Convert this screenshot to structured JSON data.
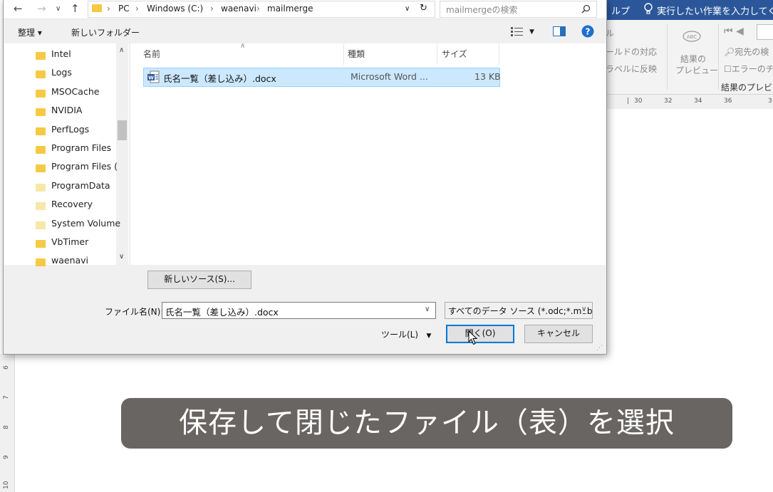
{
  "word": {
    "ribbon_tab": "ルプ",
    "tell_me": "実行したい作業を入力してくださ",
    "ribbon_fragments": {
      "group_a_1": "ル",
      "group_a_2": "ールドの対応",
      "group_a_3": "ラベルに反映",
      "preview_1": "結果の",
      "preview_2": "プレビュー",
      "right_1": "宛先の検",
      "right_2": "エラーのチ",
      "group_label": "結果のプレビュ"
    },
    "ruler_h": [
      "30",
      "32",
      "34",
      "36",
      "3"
    ],
    "ruler_v": [
      "6",
      "7",
      "8",
      "9",
      "10"
    ]
  },
  "dialog": {
    "path": [
      "PC",
      "Windows (C:)",
      "waenavi",
      "mailmerge"
    ],
    "search_placeholder": "mailmergeの検索",
    "organize_label": "整理 ▾",
    "new_folder_label": "新しいフォルダー",
    "nav_folders": [
      {
        "name": "Intel"
      },
      {
        "name": "Logs"
      },
      {
        "name": "MSOCache"
      },
      {
        "name": "NVIDIA"
      },
      {
        "name": "PerfLogs"
      },
      {
        "name": "Program Files"
      },
      {
        "name": "Program Files ("
      },
      {
        "name": "ProgramData"
      },
      {
        "name": "Recovery"
      },
      {
        "name": "System Volume"
      },
      {
        "name": "VbTimer"
      },
      {
        "name": "waenavi"
      }
    ],
    "columns": {
      "name": "名前",
      "type": "種類",
      "size": "サイズ"
    },
    "files": [
      {
        "name": "氏名一覧（差し込み）.docx",
        "type": "Microsoft Word ...",
        "size": "13 KB"
      }
    ],
    "new_source_button": "新しいソース(S)...",
    "filename_label": "ファイル名(N):",
    "filename_value": "氏名一覧（差し込み）.docx",
    "filetype_value": "すべてのデータ ソース (*.odc;*.mdb",
    "tools_label": "ツール(L)",
    "open_button": "開く(O)",
    "cancel_button": "キャンセル"
  },
  "caption": "保存して閉じたファイル（表）を選択",
  "colors": {
    "word_blue": "#2b579a",
    "selection": "#cce8ff",
    "caption_bg": "#696563",
    "help_blue": "#1e6fd0"
  }
}
